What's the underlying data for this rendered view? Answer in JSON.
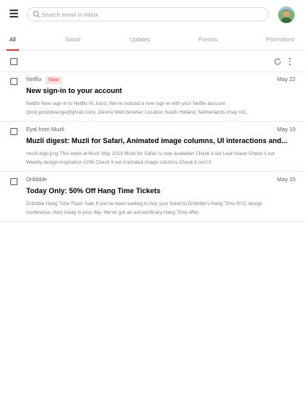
{
  "header": {
    "menu_icon": "hamburger-menu-icon",
    "search": {
      "placeholder": "Search email in inbox",
      "value": "",
      "icon": "search-icon"
    },
    "avatar_icon": "user-avatar"
  },
  "tabs": [
    {
      "label": "All",
      "active": true
    },
    {
      "label": "Social",
      "active": false
    },
    {
      "label": "Updates",
      "active": false
    },
    {
      "label": "Forums",
      "active": false
    },
    {
      "label": "Promotions",
      "active": false
    }
  ],
  "toolbar": {
    "refresh_icon": "refresh-icon",
    "more_icon": "more-vertical-icon"
  },
  "emails": [
    {
      "sender": "Netflix",
      "badge": "New",
      "date": "May 22",
      "subject": "New sign-in to your account",
      "preview": "Netflix New sign-in to Netflix Hi Joost, We've noticed a new sign-in with your Netflix account (post.joostdelange@gmail.com). Device Web browser Location South Holland, Netherlands (may not..."
    },
    {
      "sender": "Eyal from Muzli",
      "badge": "",
      "date": "May 19",
      "subject": "Muzli digest: Muzli for Safari, Animated image columns, UI interactions and...",
      "preview": "muzli-logo.png This week at Muzli May 2019 Muzli for Safari is now available! Check it out Leaf shave Check it out Weekly design inspiration #206 Check it out Animated image columns Check it out UI"
    },
    {
      "sender": "Dribbble",
      "badge": "",
      "date": "May 15",
      "subject": "Today Only: 50% Off Hang Time Tickets",
      "preview": "Dribbble Hang Time Flash Sale If you've been waiting to buy your ticket to Dribbble's Hang Time NYC design conference, then today is your day. We've got an extraordinary Hang Time offer,"
    }
  ],
  "colors": {
    "accent": "#e8453c",
    "badge_bg": "#fde3e1",
    "divider": "#e8eaed",
    "muted_text": "#80868b"
  }
}
